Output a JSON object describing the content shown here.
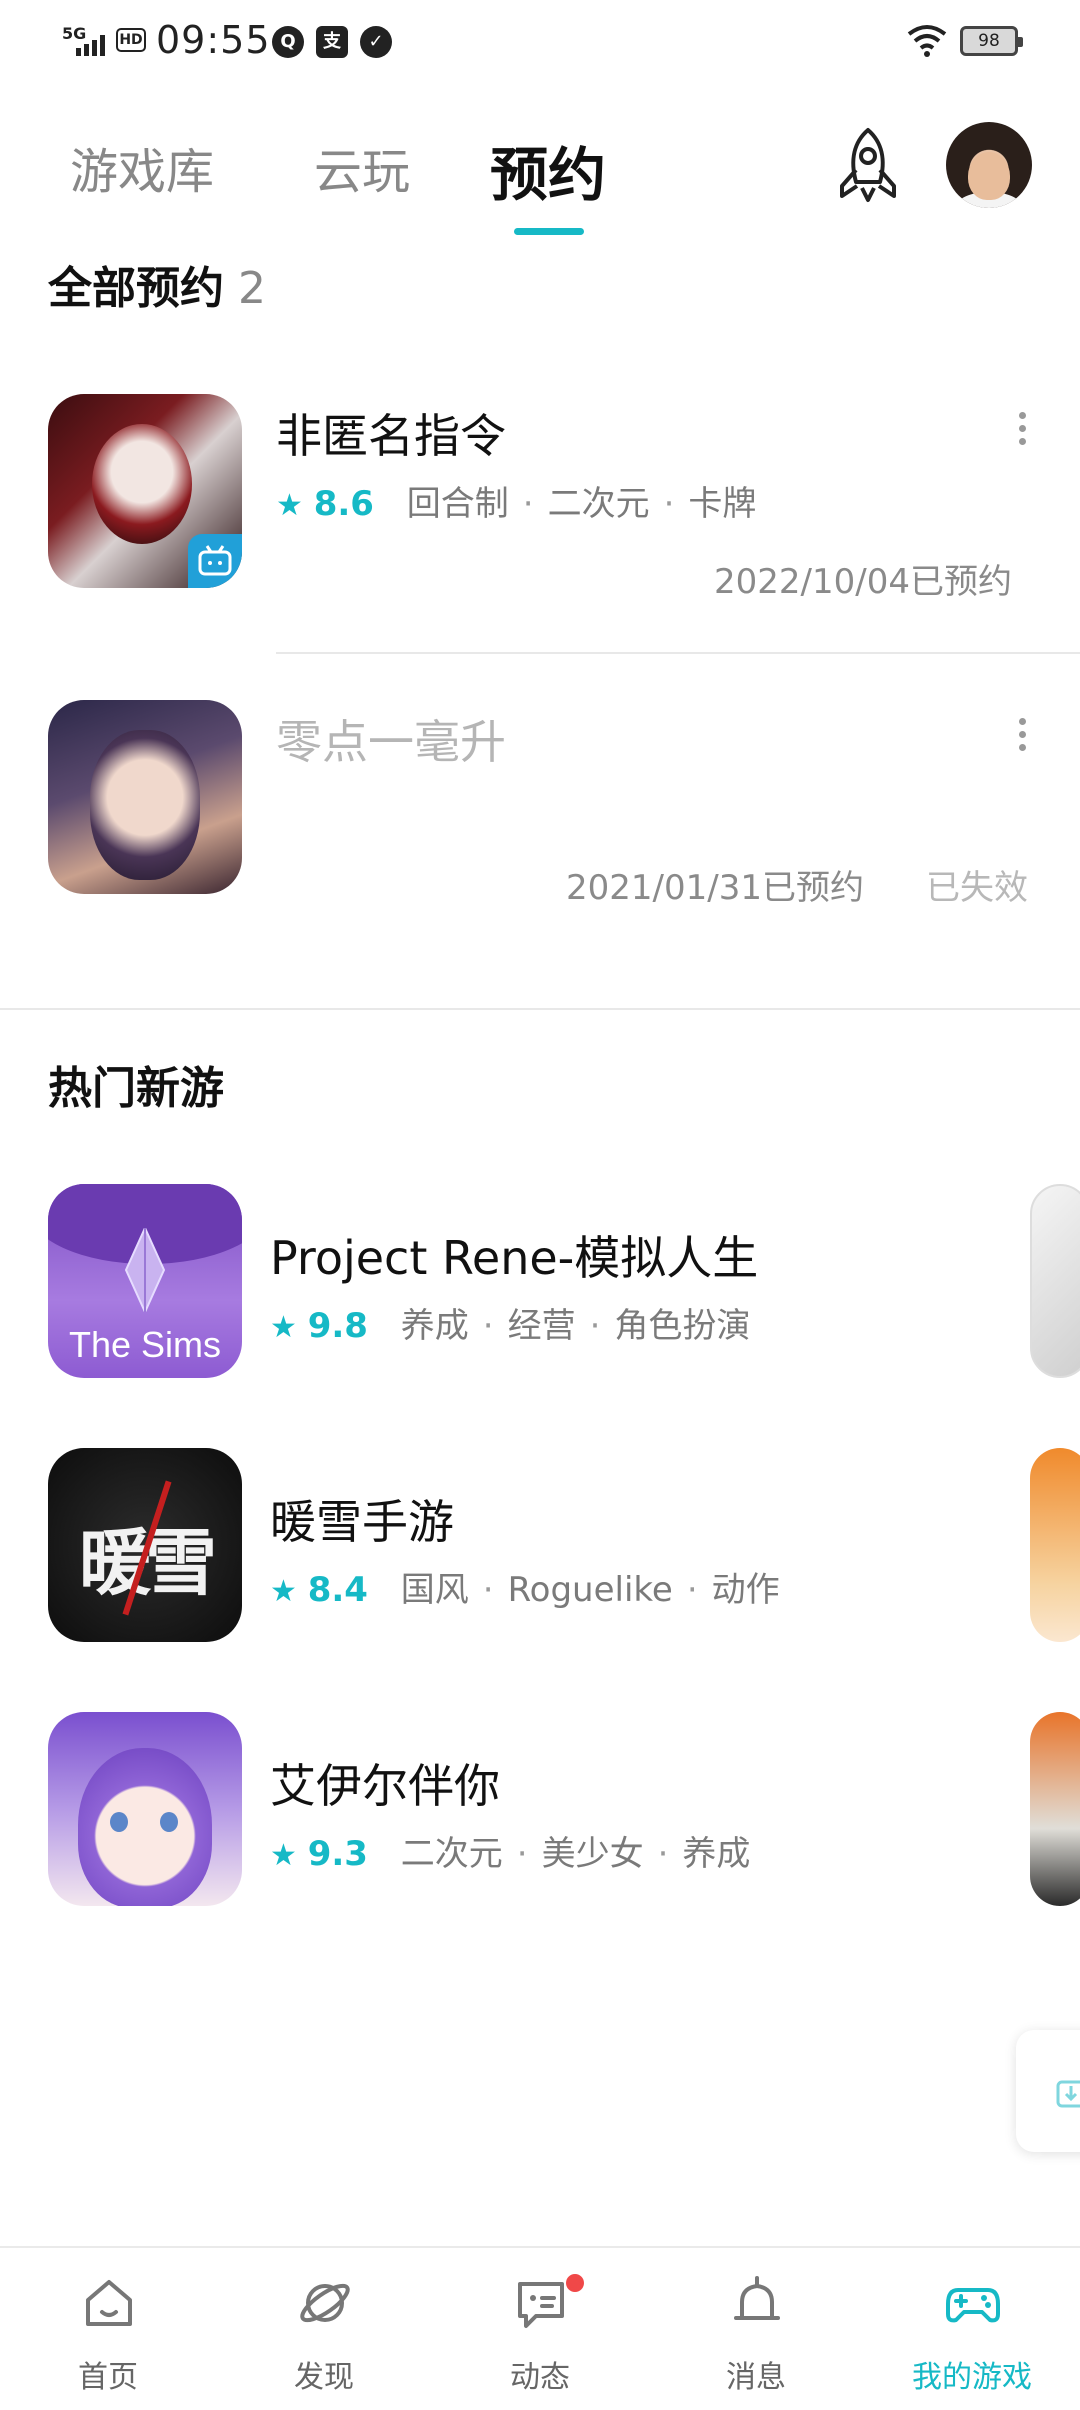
{
  "status_bar": {
    "network": "5G",
    "hd": "HD",
    "time": "09:55",
    "battery": "98"
  },
  "top_tabs": [
    {
      "label": "游戏库"
    },
    {
      "label": "云玩"
    },
    {
      "label": "预约"
    }
  ],
  "reservations": {
    "title": "全部预约",
    "count": "2",
    "items": [
      {
        "name": "非匿名指令",
        "rating": "8.6",
        "tags": [
          "回合制",
          "二次元",
          "卡牌"
        ],
        "reserve_date": "2022/10/04已预约"
      },
      {
        "name": "零点一毫升",
        "reserve_date": "2021/01/31已预约",
        "status": "已失效"
      }
    ]
  },
  "hot_new": {
    "title": "热门新游",
    "items": [
      {
        "name": "Project Rene-模拟人生",
        "rating": "9.8",
        "tags": [
          "养成",
          "经营",
          "角色扮演"
        ],
        "icon_text": "The Sims"
      },
      {
        "name": "暖雪手游",
        "rating": "8.4",
        "tags": [
          "国风",
          "Roguelike",
          "动作"
        ],
        "icon_text": "暖雪"
      },
      {
        "name": "艾伊尔伴你",
        "rating": "9.3",
        "tags": [
          "二次元",
          "美少女",
          "养成"
        ]
      }
    ]
  },
  "bottom_nav": [
    {
      "label": "首页",
      "icon": "home-icon"
    },
    {
      "label": "发现",
      "icon": "planet-icon"
    },
    {
      "label": "动态",
      "icon": "chat-icon"
    },
    {
      "label": "消息",
      "icon": "bell-icon"
    },
    {
      "label": "我的游戏",
      "icon": "gamepad-icon"
    }
  ],
  "colors": {
    "accent": "#16b9c6",
    "notification": "#f04848"
  }
}
